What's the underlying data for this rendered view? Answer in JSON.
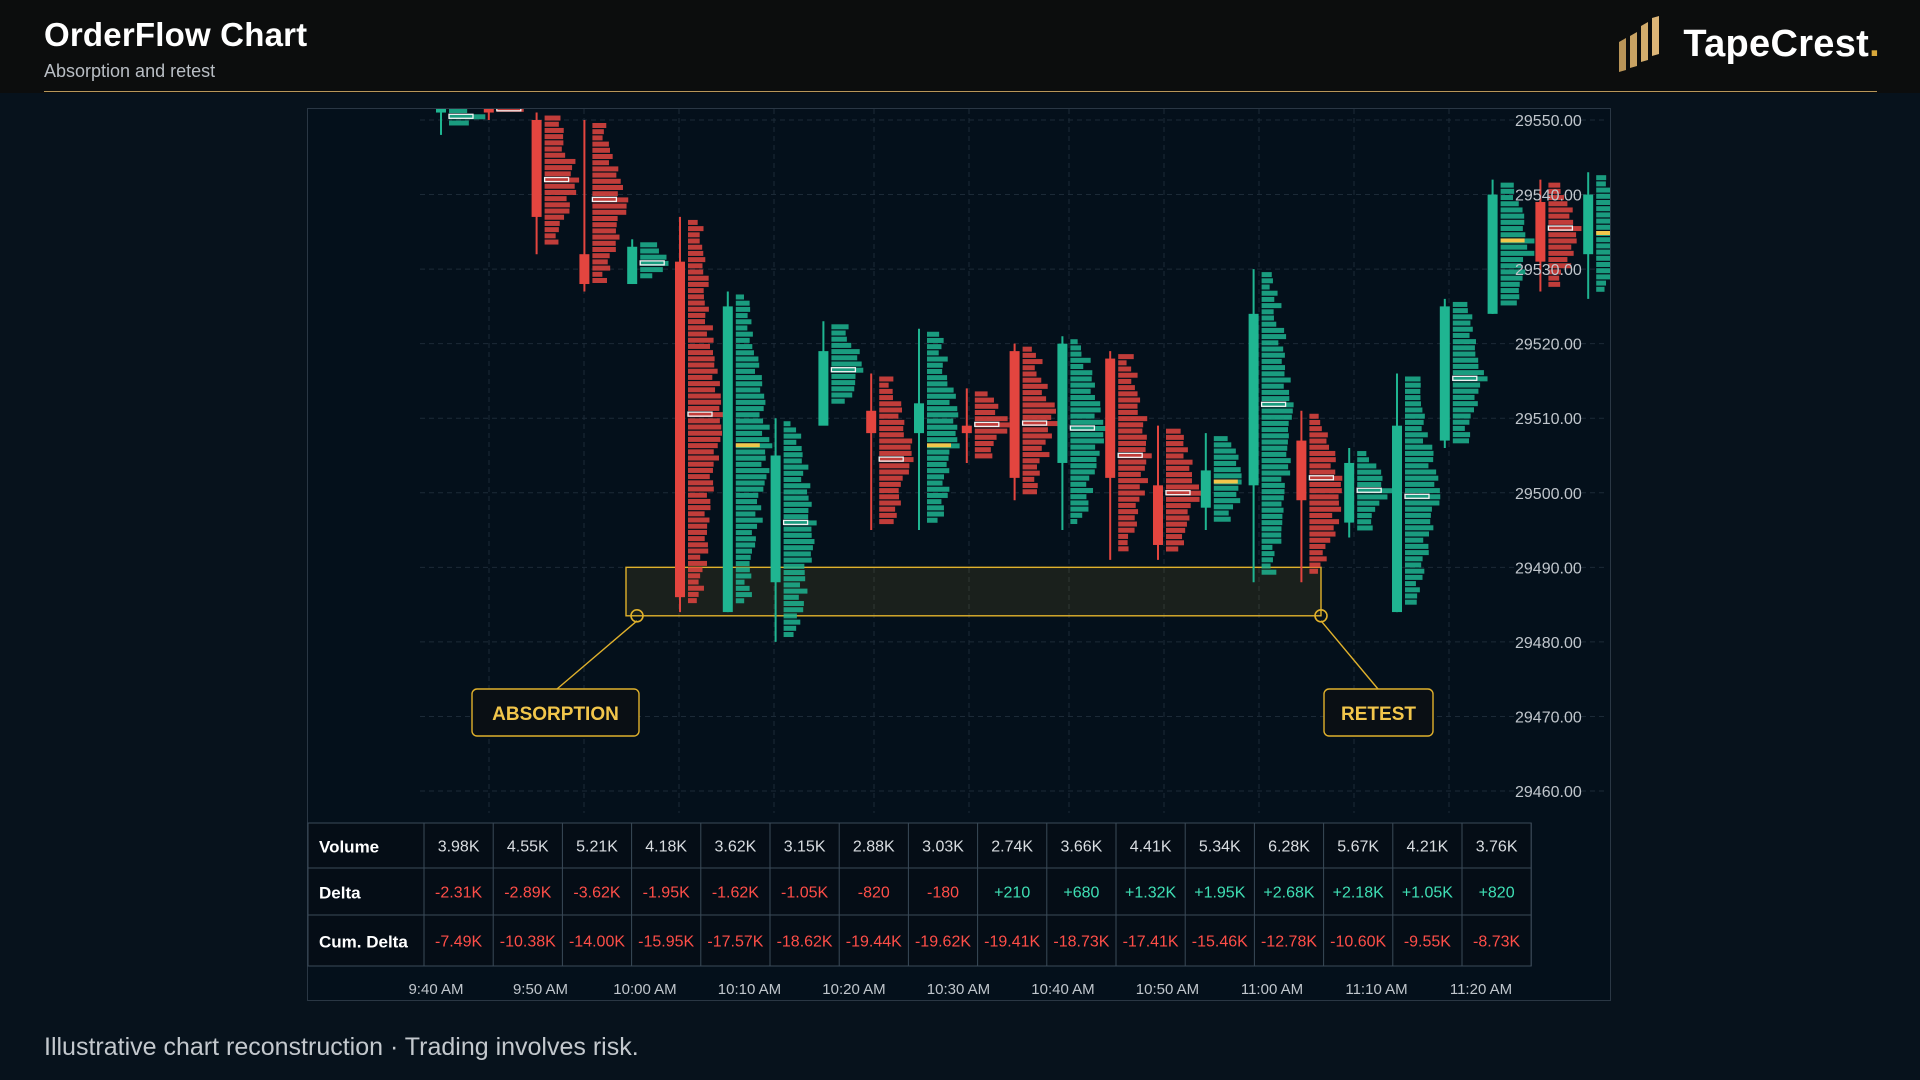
{
  "header": {
    "title": "OrderFlow Chart",
    "subtitle": "Absorption and retest",
    "brand_name": "TapeCrest",
    "brand_dot": "."
  },
  "footer": {
    "note": "Illustrative chart reconstruction · Trading involves risk."
  },
  "colors": {
    "up": "#1fb591",
    "down": "#e3453f",
    "zone": "#e0b12c",
    "accent": "#d9a83a",
    "background": "#04101b"
  },
  "chart_data": {
    "type": "candlestick",
    "grid": true,
    "y_axis": {
      "position": "right",
      "ticks": [
        "29550.00",
        "29540.00",
        "29530.00",
        "29520.00",
        "29510.00",
        "29500.00",
        "29490.00",
        "29480.00",
        "29470.00",
        "29460.00"
      ],
      "ylim": [
        29459,
        29551
      ]
    },
    "x_labels": [
      "9:40 AM",
      "9:50 AM",
      "10:00 AM",
      "10:10 AM",
      "10:20 AM",
      "10:30 AM",
      "10:40 AM",
      "10:50 AM",
      "11:00 AM",
      "11:10 AM",
      "11:20 AM"
    ],
    "candles": [
      {
        "o": 29551.0,
        "h": 29552.0,
        "l": 29548.0,
        "c": 29551.5
      },
      {
        "o": 29552.0,
        "h": 29553.0,
        "l": 29550.0,
        "c": 29551.0
      },
      {
        "o": 29550.0,
        "h": 29551.0,
        "l": 29532.0,
        "c": 29537.0
      },
      {
        "o": 29532.0,
        "h": 29550.0,
        "l": 29527.0,
        "c": 29528.0
      },
      {
        "o": 29528.0,
        "h": 29534.0,
        "l": 29528.0,
        "c": 29533.0
      },
      {
        "o": 29531.0,
        "h": 29537.0,
        "l": 29484.0,
        "c": 29486.0
      },
      {
        "o": 29484.0,
        "h": 29527.0,
        "l": 29484.0,
        "c": 29525.0
      },
      {
        "o": 29488.0,
        "h": 29510.0,
        "l": 29480.0,
        "c": 29505.0
      },
      {
        "o": 29509.0,
        "h": 29523.0,
        "l": 29511.0,
        "c": 29519.0
      },
      {
        "o": 29511.0,
        "h": 29516.0,
        "l": 29495.0,
        "c": 29508.0
      },
      {
        "o": 29508.0,
        "h": 29522.0,
        "l": 29495.0,
        "c": 29512.0
      },
      {
        "o": 29509.0,
        "h": 29514.0,
        "l": 29504.0,
        "c": 29508.0
      },
      {
        "o": 29519.0,
        "h": 29520.0,
        "l": 29499.0,
        "c": 29502.0
      },
      {
        "o": 29504.0,
        "h": 29521.0,
        "l": 29495.0,
        "c": 29520.0
      },
      {
        "o": 29518.0,
        "h": 29519.0,
        "l": 29491.0,
        "c": 29502.0
      },
      {
        "o": 29501.0,
        "h": 29509.0,
        "l": 29491.0,
        "c": 29493.0
      },
      {
        "o": 29498.0,
        "h": 29508.0,
        "l": 29495.0,
        "c": 29503.0
      },
      {
        "o": 29501.0,
        "h": 29530.0,
        "l": 29488.0,
        "c": 29524.0
      },
      {
        "o": 29507.0,
        "h": 29511.0,
        "l": 29488.0,
        "c": 29499.0
      },
      {
        "o": 29496.0,
        "h": 29506.0,
        "l": 29494.0,
        "c": 29504.0
      },
      {
        "o": 29484.0,
        "h": 29516.0,
        "l": 29484.0,
        "c": 29509.0
      },
      {
        "o": 29507.0,
        "h": 29526.0,
        "l": 29506.0,
        "c": 29525.0
      },
      {
        "o": 29524.0,
        "h": 29542.0,
        "l": 29524.0,
        "c": 29540.0
      },
      {
        "o": 29539.0,
        "h": 29542.0,
        "l": 29527.0,
        "c": 29531.0
      },
      {
        "o": 29532.0,
        "h": 29543.0,
        "l": 29526.0,
        "c": 29540.0
      }
    ],
    "zone": {
      "low": 29483.5,
      "high": 29490.0
    },
    "annotations": [
      {
        "label": "ABSORPTION",
        "anchor_candle": 5
      },
      {
        "label": "RETEST",
        "anchor_candle": 21
      }
    ],
    "stats_table": {
      "rows": [
        {
          "label": "Volume",
          "values": [
            "3.98K",
            "4.55K",
            "5.21K",
            "4.18K",
            "3.62K",
            "3.15K",
            "2.88K",
            "3.03K",
            "2.74K",
            "3.66K",
            "4.41K",
            "5.34K",
            "6.28K",
            "5.67K",
            "4.21K",
            "3.76K"
          ]
        },
        {
          "label": "Delta",
          "values": [
            "-2.31K",
            "-2.89K",
            "-3.62K",
            "-1.95K",
            "-1.62K",
            "-1.05K",
            "-820",
            "-180",
            "+210",
            "+680",
            "+1.32K",
            "+1.95K",
            "+2.68K",
            "+2.18K",
            "+1.05K",
            "+820"
          ]
        },
        {
          "label": "Cum. Delta",
          "values": [
            "-7.49K",
            "-10.38K",
            "-14.00K",
            "-15.95K",
            "-17.57K",
            "-18.62K",
            "-19.44K",
            "-19.62K",
            "-19.41K",
            "-18.73K",
            "-17.41K",
            "-15.46K",
            "-12.78K",
            "-10.60K",
            "-9.55K",
            "-8.73K"
          ]
        }
      ]
    }
  }
}
